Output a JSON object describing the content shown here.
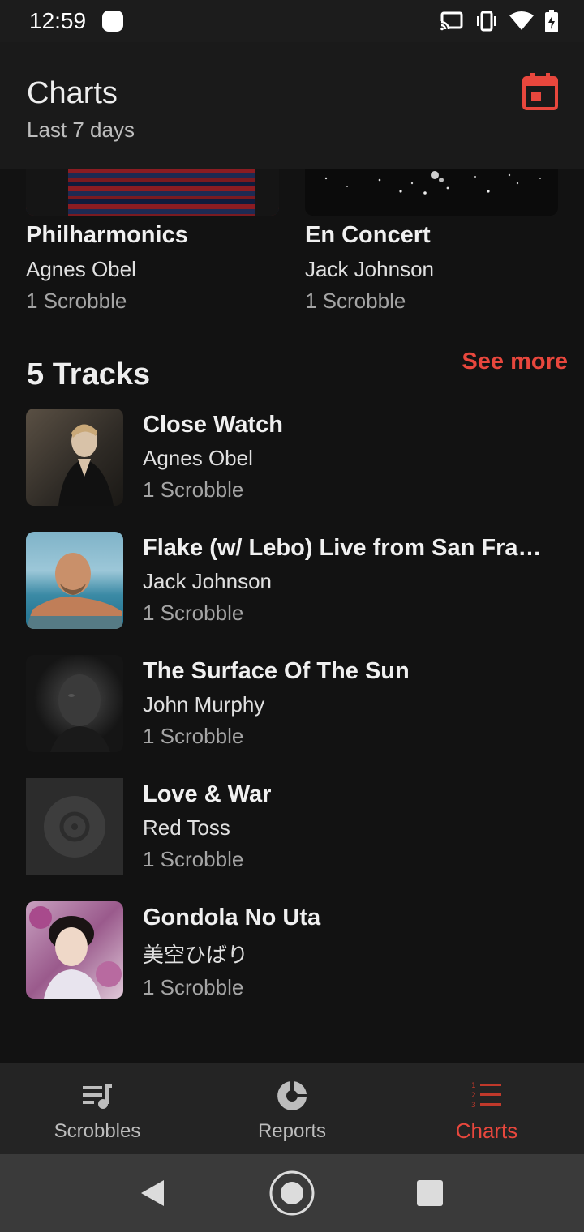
{
  "status_bar": {
    "time": "12:59"
  },
  "header": {
    "title": "Charts",
    "subtitle": "Last 7 days",
    "calendar_icon": "calendar-icon",
    "accent_color": "#e8473d"
  },
  "albums": [
    {
      "title": "Philharmonics",
      "artist": "Agnes Obel",
      "count": "1 Scrobble"
    },
    {
      "title": "En Concert",
      "artist": "Jack Johnson",
      "count": "1 Scrobble"
    }
  ],
  "tracks_section": {
    "title": "5 Tracks",
    "see_more": "See more",
    "items": [
      {
        "title": "Close Watch",
        "artist": "Agnes Obel",
        "count": "1 Scrobble"
      },
      {
        "title": "Flake (w/ Lebo) Live from San Fra…",
        "artist": "Jack Johnson",
        "count": "1 Scrobble"
      },
      {
        "title": "The Surface Of The Sun",
        "artist": "John Murphy",
        "count": "1 Scrobble"
      },
      {
        "title": "Love & War",
        "artist": "Red Toss",
        "count": "1 Scrobble"
      },
      {
        "title": "Gondola No Uta",
        "artist": "美空ひばり",
        "count": "1 Scrobble"
      }
    ]
  },
  "bottom_nav": {
    "items": [
      {
        "label": "Scrobbles",
        "icon": "playlist-icon",
        "active": false
      },
      {
        "label": "Reports",
        "icon": "pie-chart-icon",
        "active": false
      },
      {
        "label": "Charts",
        "icon": "ranked-list-icon",
        "active": true
      }
    ]
  }
}
